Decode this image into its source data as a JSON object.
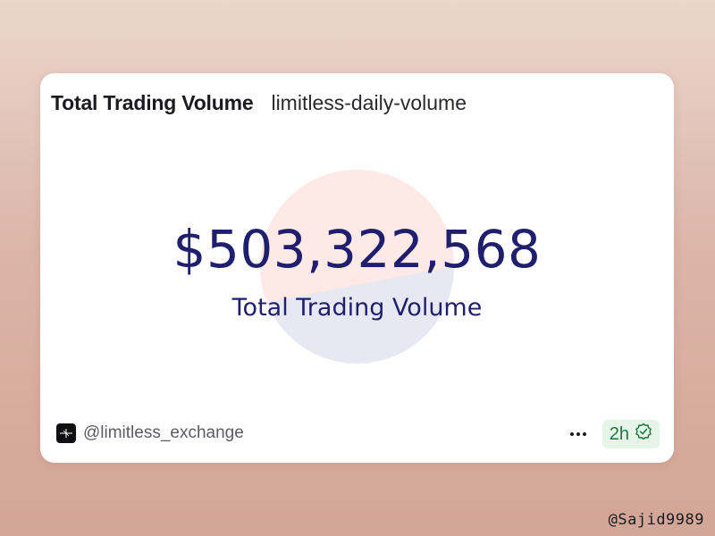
{
  "card": {
    "title": "Total Trading Volume",
    "query_name": "limitless-daily-volume",
    "metric_value": "$503,322,568",
    "metric_label": "Total Trading Volume",
    "author_handle": "@limitless_exchange",
    "refresh_age": "2h"
  },
  "watermark": "@Sajid9989",
  "colors": {
    "metric_text": "#1f1f6e",
    "badge_bg": "#e6f4ea",
    "badge_text": "#1f7a3b",
    "circle_top": "#fde9e6",
    "circle_bottom": "#e8e8f2"
  },
  "icons": {
    "author_logo": "limitless-logo-icon",
    "more": "more-dots-icon",
    "verified": "verified-check-icon"
  }
}
